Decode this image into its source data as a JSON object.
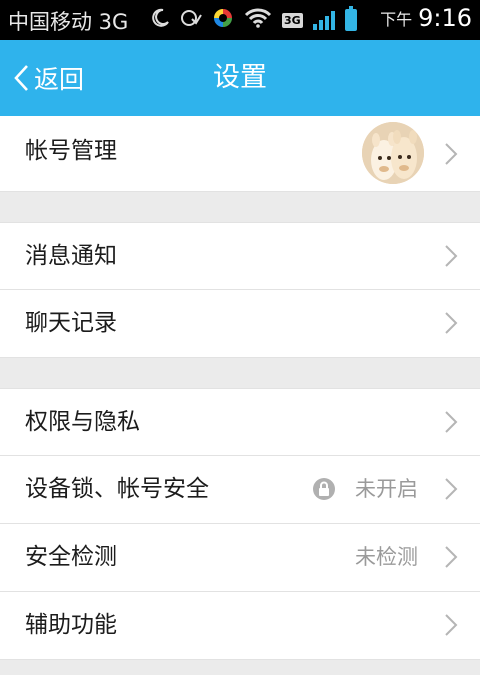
{
  "status_bar": {
    "carrier": "中国移动 3G",
    "network_badge": "3G",
    "time_prefix": "下午",
    "time": "9:16",
    "icons": [
      "moon-icon",
      "notification-icon",
      "sync-icon",
      "wifi-icon",
      "signal-icon",
      "battery-icon"
    ]
  },
  "header": {
    "back_label": "返回",
    "title": "设置"
  },
  "settings": {
    "account": {
      "label": "帐号管理"
    },
    "messages": {
      "label": "消息通知"
    },
    "chat_history": {
      "label": "聊天记录"
    },
    "privacy": {
      "label": "权限与隐私"
    },
    "device_lock": {
      "label": "设备锁、帐号安全",
      "value": "未开启"
    },
    "security_check": {
      "label": "安全检测",
      "value": "未检测"
    },
    "accessibility": {
      "label": "辅助功能"
    }
  },
  "colors": {
    "header_bg": "#2fb3ec",
    "page_bg": "#ebebeb",
    "row_bg": "#ffffff",
    "secondary_text": "#9a9a9a"
  }
}
